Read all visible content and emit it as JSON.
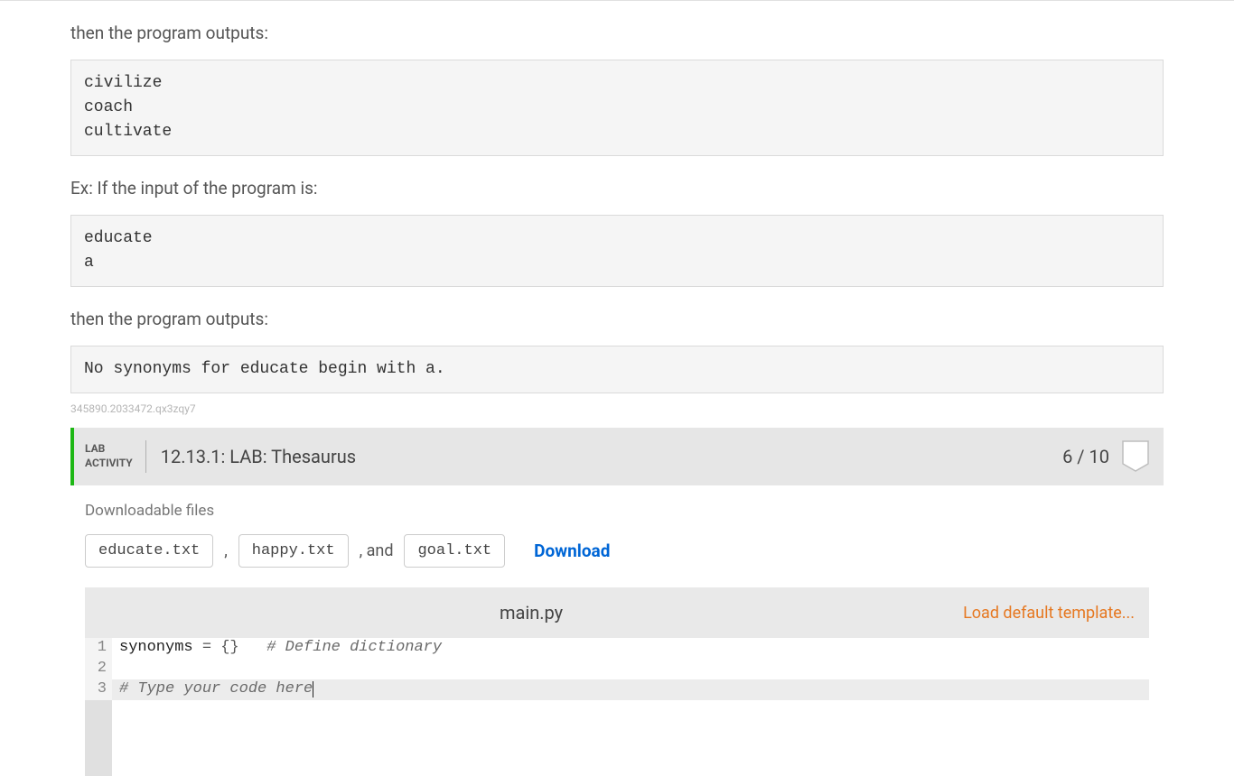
{
  "texts": {
    "output_intro_1": "then the program outputs:",
    "codebox_1": "civilize\ncoach\ncultivate",
    "input_intro_2": "Ex: If the input of the program is:",
    "codebox_2": "educate\na",
    "output_intro_2": "then the program outputs:",
    "codebox_3": "No synonyms for educate begin with a.",
    "watermark": "345890.2033472.qx3zqy7"
  },
  "lab": {
    "label_line1": "LAB",
    "label_line2": "ACTIVITY",
    "title": "12.13.1: LAB: Thesaurus",
    "score": "6 / 10"
  },
  "downloads": {
    "title": "Downloadable files",
    "files": [
      "educate.txt",
      "happy.txt",
      "goal.txt"
    ],
    "sep1": ",",
    "sep2": ", and",
    "download_label": "Download"
  },
  "editor": {
    "filename": "main.py",
    "load_template": "Load default template...",
    "lines": [
      {
        "n": "1",
        "raw": "synonyms = {}   # Define dictionary"
      },
      {
        "n": "2",
        "raw": ""
      },
      {
        "n": "3",
        "raw": "# Type your code here"
      }
    ],
    "line1_ident": "synonyms",
    "line1_rest_ops": " = {}   ",
    "line1_comment": "# Define dictionary",
    "line3_comment": "# Type your code here"
  }
}
